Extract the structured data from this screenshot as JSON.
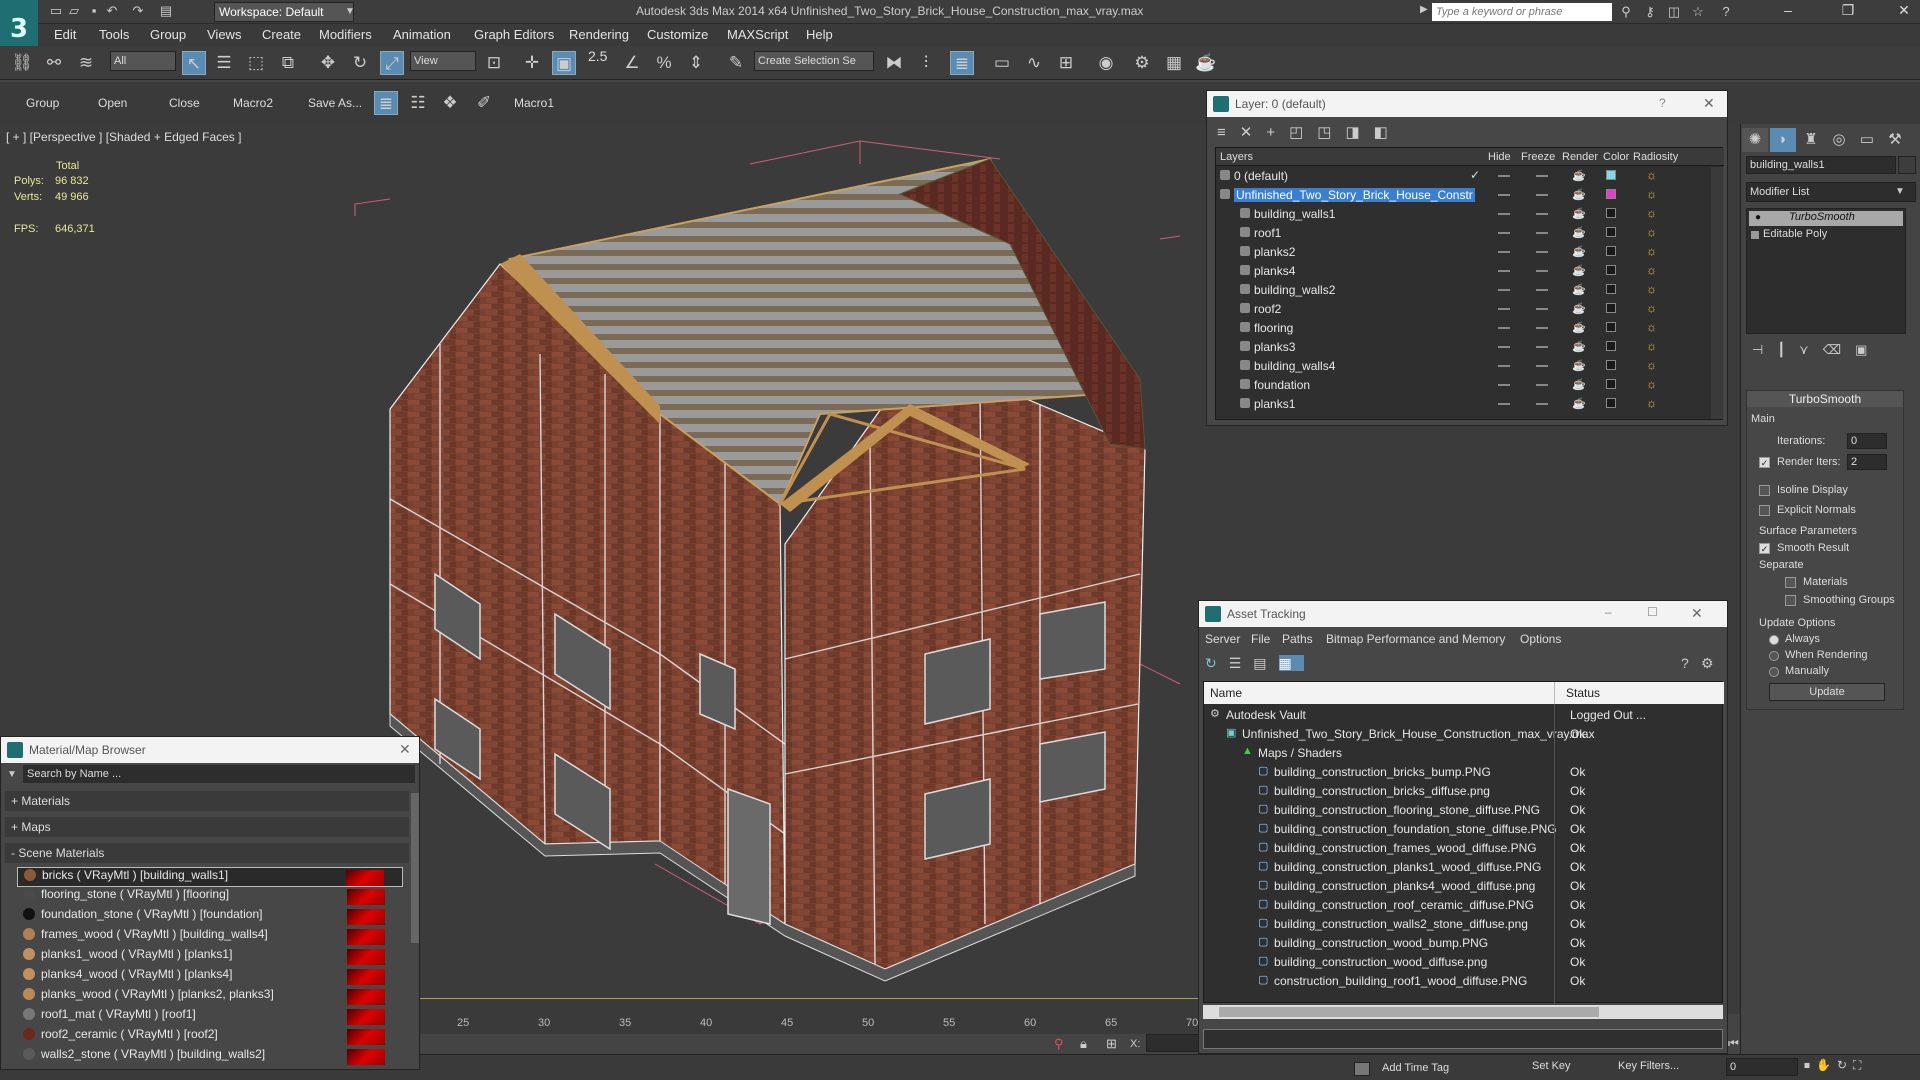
{
  "app": {
    "title": "Autodesk 3ds Max  2014 x64    Unfinished_Two_Story_Brick_House_Construction_max_vray.max",
    "logo": "3",
    "workspace": "Workspace: Default",
    "search_placeholder": "Type a keyword or phrase",
    "window_controls": [
      "minimize-icon",
      "restore-icon",
      "close-icon"
    ]
  },
  "menubar": [
    "Edit",
    "Tools",
    "Group",
    "Views",
    "Create",
    "Modifiers",
    "Animation",
    "Graph Editors",
    "Rendering",
    "Customize",
    "MAXScript",
    "Help"
  ],
  "toolbar": {
    "selection_filter": "All",
    "ref_coord": "View",
    "snap_angle": "2.5",
    "named_selection": "Create Selection Se"
  },
  "shelf": {
    "buttons": [
      "Group",
      "Open",
      "Close",
      "Macro2",
      "Save As...",
      "Macro1"
    ]
  },
  "viewport": {
    "label": "[ + ] [Perspective ] [Shaded + Edged Faces ]",
    "stats": {
      "header": "Total",
      "polys_label": "Polys:",
      "polys_value": "96 832",
      "verts_label": "Verts:",
      "verts_value": "49 966",
      "fps_label": "FPS:",
      "fps_value": "646,371"
    }
  },
  "layer_manager": {
    "title": "Layer: 0 (default)",
    "help": "?",
    "columns": [
      "Layers",
      "Hide",
      "Freeze",
      "Render",
      "Color",
      "Radiosity"
    ],
    "rows": [
      {
        "name": "0 (default)",
        "color": "#7fd8e8",
        "level": 0,
        "selected": false,
        "current": true
      },
      {
        "name": "Unfinished_Two_Story_Brick_House_Constr",
        "color": "#e040c8",
        "level": 0,
        "selected": true,
        "current": false
      },
      {
        "name": "building_walls1",
        "color": "#1a1a1a",
        "level": 1,
        "selected": false,
        "current": false
      },
      {
        "name": "roof1",
        "color": "#1a1a1a",
        "level": 1,
        "selected": false,
        "current": false
      },
      {
        "name": "planks2",
        "color": "#1a1a1a",
        "level": 1,
        "selected": false,
        "current": false
      },
      {
        "name": "planks4",
        "color": "#1a1a1a",
        "level": 1,
        "selected": false,
        "current": false
      },
      {
        "name": "building_walls2",
        "color": "#1a1a1a",
        "level": 1,
        "selected": false,
        "current": false
      },
      {
        "name": "roof2",
        "color": "#1a1a1a",
        "level": 1,
        "selected": false,
        "current": false
      },
      {
        "name": "flooring",
        "color": "#1a1a1a",
        "level": 1,
        "selected": false,
        "current": false
      },
      {
        "name": "planks3",
        "color": "#1a1a1a",
        "level": 1,
        "selected": false,
        "current": false
      },
      {
        "name": "building_walls4",
        "color": "#1a1a1a",
        "level": 1,
        "selected": false,
        "current": false
      },
      {
        "name": "foundation",
        "color": "#1a1a1a",
        "level": 1,
        "selected": false,
        "current": false
      },
      {
        "name": "planks1",
        "color": "#1a1a1a",
        "level": 1,
        "selected": false,
        "current": false
      }
    ]
  },
  "asset_tracking": {
    "title": "Asset Tracking",
    "menu": [
      "Server",
      "File",
      "Paths",
      "Bitmap Performance and Memory",
      "Options"
    ],
    "columns": [
      "Name",
      "Status"
    ],
    "rows": [
      {
        "name": "Autodesk Vault",
        "status": "Logged Out ...",
        "level": 0
      },
      {
        "name": "Unfinished_Two_Story_Brick_House_Construction_max_vray.max",
        "status": "Ok",
        "level": 1
      },
      {
        "name": "Maps / Shaders",
        "status": "",
        "level": 2
      },
      {
        "name": "building_construction_bricks_bump.PNG",
        "status": "Ok",
        "level": 3
      },
      {
        "name": "building_construction_bricks_diffuse.png",
        "status": "Ok",
        "level": 3
      },
      {
        "name": "building_construction_flooring_stone_diffuse.PNG",
        "status": "Ok",
        "level": 3
      },
      {
        "name": "building_construction_foundation_stone_diffuse.PNG",
        "status": "Ok",
        "level": 3
      },
      {
        "name": "building_construction_frames_wood_diffuse.PNG",
        "status": "Ok",
        "level": 3
      },
      {
        "name": "building_construction_planks1_wood_diffuse.PNG",
        "status": "Ok",
        "level": 3
      },
      {
        "name": "building_construction_planks4_wood_diffuse.png",
        "status": "Ok",
        "level": 3
      },
      {
        "name": "building_construction_roof_ceramic_diffuse.PNG",
        "status": "Ok",
        "level": 3
      },
      {
        "name": "building_construction_walls2_stone_diffuse.png",
        "status": "Ok",
        "level": 3
      },
      {
        "name": "building_construction_wood_bump.PNG",
        "status": "Ok",
        "level": 3
      },
      {
        "name": "building_construction_wood_diffuse.png",
        "status": "Ok",
        "level": 3
      },
      {
        "name": "construction_building_roof1_wood_diffuse.PNG",
        "status": "Ok",
        "level": 3
      }
    ]
  },
  "material_browser": {
    "title": "Material/Map Browser",
    "search_placeholder": "Search by Name ...",
    "groups": [
      "+ Materials",
      "+ Maps",
      "- Scene Materials"
    ],
    "items": [
      {
        "label": "bricks  ( VRayMtl ) [building_walls1]",
        "swatch": "#8a5a3a",
        "selected": true
      },
      {
        "label": "flooring_stone  ( VRayMtl ) [flooring]",
        "swatch": "#4a4a4a",
        "selected": false
      },
      {
        "label": "foundation_stone  ( VRayMtl ) [foundation]",
        "swatch": "#111111",
        "selected": false
      },
      {
        "label": "frames_wood  ( VRayMtl ) [building_walls4]",
        "swatch": "#b08050",
        "selected": false
      },
      {
        "label": "planks1_wood  ( VRayMtl ) [planks1]",
        "swatch": "#c09060",
        "selected": false
      },
      {
        "label": "planks4_wood  ( VRayMtl ) [planks4]",
        "swatch": "#c09060",
        "selected": false
      },
      {
        "label": "planks_wood  ( VRayMtl ) [planks2, planks3]",
        "swatch": "#b88a58",
        "selected": false
      },
      {
        "label": "roof1_mat  ( VRayMtl ) [roof1]",
        "swatch": "#777777",
        "selected": false
      },
      {
        "label": "roof2_ceramic  ( VRayMtl ) [roof2]",
        "swatch": "#6a2a1a",
        "selected": false
      },
      {
        "label": "walls2_stone  ( VRayMtl ) [building_walls2]",
        "swatch": "#5a5a5a",
        "selected": false
      }
    ]
  },
  "command_panel": {
    "object_name": "building_walls1",
    "modifier_list": "Modifier List",
    "stack": [
      "TurboSmooth",
      "Editable Poly"
    ],
    "turbosmooth": {
      "title": "TurboSmooth",
      "main": "Main",
      "iterations_label": "Iterations:",
      "iterations_value": "0",
      "render_iters_label": "Render Iters:",
      "render_iters_value": "2",
      "isoline_label": "Isoline Display",
      "explicit_label": "Explicit Normals",
      "surface_label": "Surface Parameters",
      "smooth_label": "Smooth Result",
      "separate_label": "Separate",
      "materials_label": "Materials",
      "smoothing_label": "Smoothing Groups",
      "update_options_label": "Update Options",
      "always_label": "Always",
      "when_rendering_label": "When Rendering",
      "manually_label": "Manually",
      "update_button": "Update"
    }
  },
  "timeline": {
    "ticks": [
      "25",
      "30",
      "35",
      "40",
      "45",
      "50",
      "55",
      "60",
      "65",
      "70"
    ]
  },
  "statusbar": {
    "x_label": "X:",
    "add_time_tag": "Add Time Tag",
    "set_key": "Set Key",
    "key_filters": "Key Filters...",
    "frame_value": "0"
  }
}
